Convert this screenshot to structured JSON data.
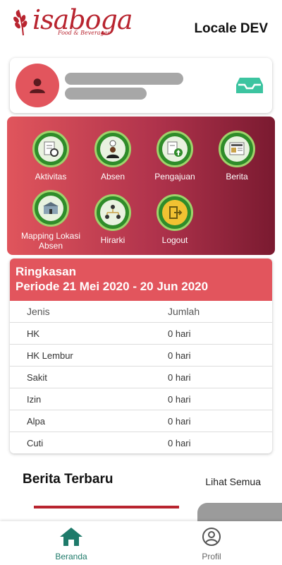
{
  "header": {
    "logo_text": "isaboga",
    "logo_sub": "Food & Beverages",
    "title": "Locale DEV"
  },
  "profile": {
    "avatar_icon": "user-icon",
    "inbox_icon": "inbox-icon"
  },
  "menu": {
    "items": [
      {
        "label": "Aktivitas",
        "icon": "clipboard-timer-icon"
      },
      {
        "label": "Absen",
        "icon": "person-clock-icon"
      },
      {
        "label": "Pengajuan",
        "icon": "document-upload-icon"
      },
      {
        "label": "Berita",
        "icon": "newspaper-icon"
      },
      {
        "label": "Mapping Lokasi Absen",
        "icon": "building-map-icon"
      },
      {
        "label": "Hirarki",
        "icon": "org-chart-icon"
      },
      {
        "label": "Logout",
        "icon": "logout-icon"
      }
    ]
  },
  "summary": {
    "title": "Ringkasan",
    "period": "Periode 21 Mei 2020 - 20 Jun 2020",
    "col_type": "Jenis",
    "col_amount": "Jumlah",
    "rows": [
      {
        "type": "HK",
        "amount": "0 hari"
      },
      {
        "type": "HK Lembur",
        "amount": "0 hari"
      },
      {
        "type": "Sakit",
        "amount": "0 hari"
      },
      {
        "type": "Izin",
        "amount": "0 hari"
      },
      {
        "type": "Alpa",
        "amount": "0 hari"
      },
      {
        "type": "Cuti",
        "amount": "0 hari"
      }
    ]
  },
  "news": {
    "title": "Berita Terbaru",
    "see_all": "Lihat Semua"
  },
  "nav": {
    "home": "Beranda",
    "profile": "Profil"
  },
  "colors": {
    "accent": "#e2555d",
    "active_nav": "#1e7a6a"
  }
}
